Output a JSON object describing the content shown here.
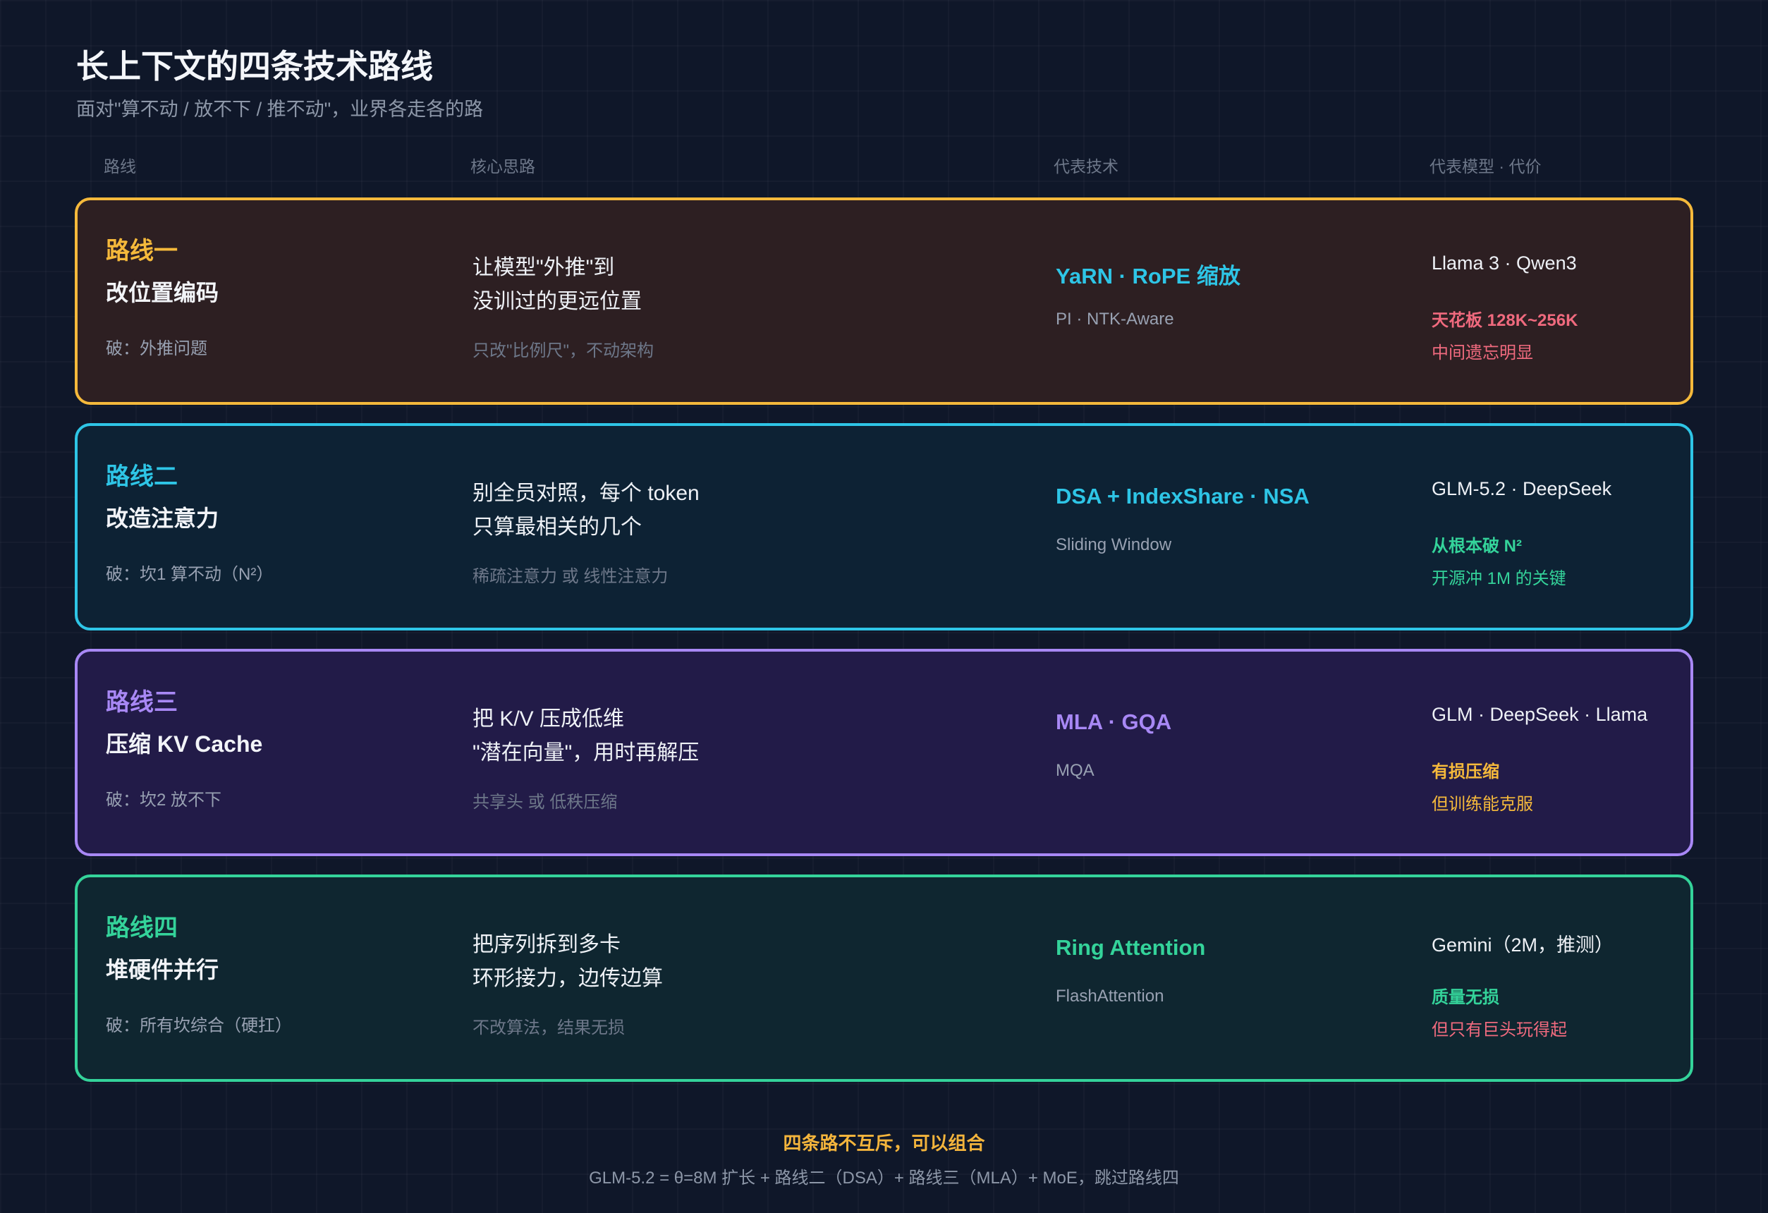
{
  "header": {
    "title": "长上下文的四条技术路线",
    "subtitle": "面对\"算不动 / 放不下 / 推不动\"，业界各走各的路"
  },
  "columns": {
    "route": "路线",
    "idea": "核心思路",
    "tech": "代表技术",
    "model": "代表模型 · 代价"
  },
  "routes": [
    {
      "label": "路线一",
      "name": "改位置编码",
      "breaks": "破：外推问题",
      "idea_line1": "让模型\"外推\"到",
      "idea_line2": "没训过的更远位置",
      "idea_note": "只改\"比例尺\"，不动架构",
      "tech_main": "YaRN · RoPE 缩放",
      "tech_sub": "PI · NTK-Aware",
      "models": "Llama 3 · Qwen3",
      "cost_line1": "天花板 128K~256K",
      "cost_line2": "中间遗忘明显",
      "colors": {
        "border": "#f5b93b",
        "background": "#2d1f22",
        "label": "#f5b93b",
        "tech": "#2ec5e6",
        "cost1": "#f06a7e",
        "cost2": "#f06a7e"
      }
    },
    {
      "label": "路线二",
      "name": "改造注意力",
      "breaks": "破：坎1 算不动（N²）",
      "idea_line1": "别全员对照，每个 token",
      "idea_line2": "只算最相关的几个",
      "idea_note": "稀疏注意力 或 线性注意力",
      "tech_main": "DSA + IndexShare · NSA",
      "tech_sub": "Sliding Window",
      "models": "GLM-5.2 · DeepSeek",
      "cost_line1": "从根本破 N²",
      "cost_line2": "开源冲 1M 的关键",
      "colors": {
        "border": "#2ec5e6",
        "background": "#0d2234",
        "label": "#2ec5e6",
        "tech": "#2ec5e6",
        "cost1": "#34d39a",
        "cost2": "#34d39a"
      }
    },
    {
      "label": "路线三",
      "name": "压缩 KV Cache",
      "breaks": "破：坎2 放不下",
      "idea_line1": "把 K/V 压成低维",
      "idea_line2": "\"潜在向量\"，用时再解压",
      "idea_note": "共享头 或 低秩压缩",
      "tech_main": "MLA · GQA",
      "tech_sub": "MQA",
      "models": "GLM · DeepSeek · Llama",
      "cost_line1": "有损压缩",
      "cost_line2": "但训练能克服",
      "colors": {
        "border": "#a888f5",
        "background": "#221b48",
        "label": "#a888f5",
        "tech": "#a888f5",
        "cost1": "#f5b93b",
        "cost2": "#f5b93b"
      }
    },
    {
      "label": "路线四",
      "name": "堆硬件并行",
      "breaks": "破：所有坎综合（硬扛）",
      "idea_line1": "把序列拆到多卡",
      "idea_line2": "环形接力，边传边算",
      "idea_note": "不改算法，结果无损",
      "tech_main": "Ring Attention",
      "tech_sub": "FlashAttention",
      "models": "Gemini（2M，推测）",
      "cost_line1": "质量无损",
      "cost_line2": "但只有巨头玩得起",
      "colors": {
        "border": "#34d39a",
        "background": "#0f2630",
        "label": "#34d39a",
        "tech": "#34d39a",
        "cost1": "#34d39a",
        "cost2": "#f06a7e"
      }
    }
  ],
  "footer": {
    "main": "四条路不互斥，可以组合",
    "sub": "GLM-5.2 = θ=8M 扩长 + 路线二（DSA）+ 路线三（MLA）+ MoE，跳过路线四"
  }
}
